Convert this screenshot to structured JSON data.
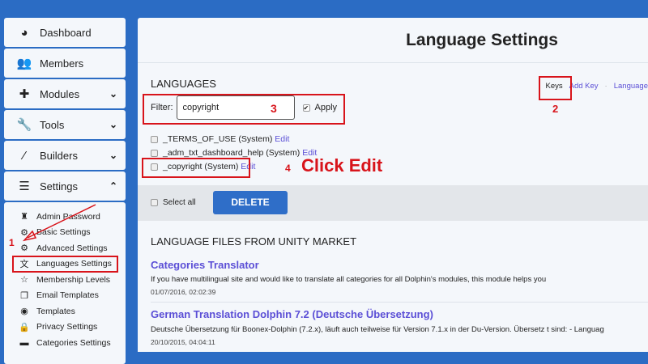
{
  "sidebar": {
    "items": [
      {
        "label": "Dashboard",
        "icon": "dashboard-icon"
      },
      {
        "label": "Members",
        "icon": "users-icon"
      },
      {
        "label": "Modules",
        "icon": "puzzle-icon"
      },
      {
        "label": "Tools",
        "icon": "wrench-icon"
      },
      {
        "label": "Builders",
        "icon": "magic-wand-icon"
      },
      {
        "label": "Settings",
        "icon": "sliders-icon"
      }
    ],
    "settings_sub": [
      "Admin Password",
      "Basic Settings",
      "Advanced Settings",
      "Languages Settings",
      "Membership Levels",
      "Email Templates",
      "Templates",
      "Privacy Settings",
      "Categories Settings"
    ]
  },
  "page": {
    "title": "Language Settings"
  },
  "languages": {
    "heading": "LANGUAGES",
    "links": [
      "Keys",
      "Add Key",
      "Language"
    ],
    "filter_label": "Filter:",
    "filter_value": "copyright",
    "apply_label": "Apply",
    "rows": [
      {
        "key": "_TERMS_OF_USE (System)",
        "edit": "Edit"
      },
      {
        "key": "_adm_txt_dashboard_help (System)",
        "edit": "Edit"
      },
      {
        "key": "_copyright (System)",
        "edit": "Edit"
      }
    ],
    "select_all": "Select all",
    "delete": "DELETE"
  },
  "market": {
    "heading": "LANGUAGE FILES FROM UNITY MARKET",
    "items": [
      {
        "title": "Categories Translator",
        "desc": "If you have multilingual site and would like to translate all categories for all Dolphin's modules, this module helps you",
        "date": "01/07/2016, 02:02:39"
      },
      {
        "title": "German Translation Dolphin 7.2 (Deutsche Übersetzung)",
        "desc": "Deutsche Übersetzung für Boonex-Dolphin (7.2.x), läuft auch teilweise für Version 7.1.x in der Du-Version. Übersetz t sind: - Languag",
        "date": "20/10/2015, 04:04:11"
      }
    ]
  },
  "annotations": {
    "n1": "1",
    "n2": "2",
    "n3": "3",
    "n4": "4",
    "click": "Click Edit"
  }
}
